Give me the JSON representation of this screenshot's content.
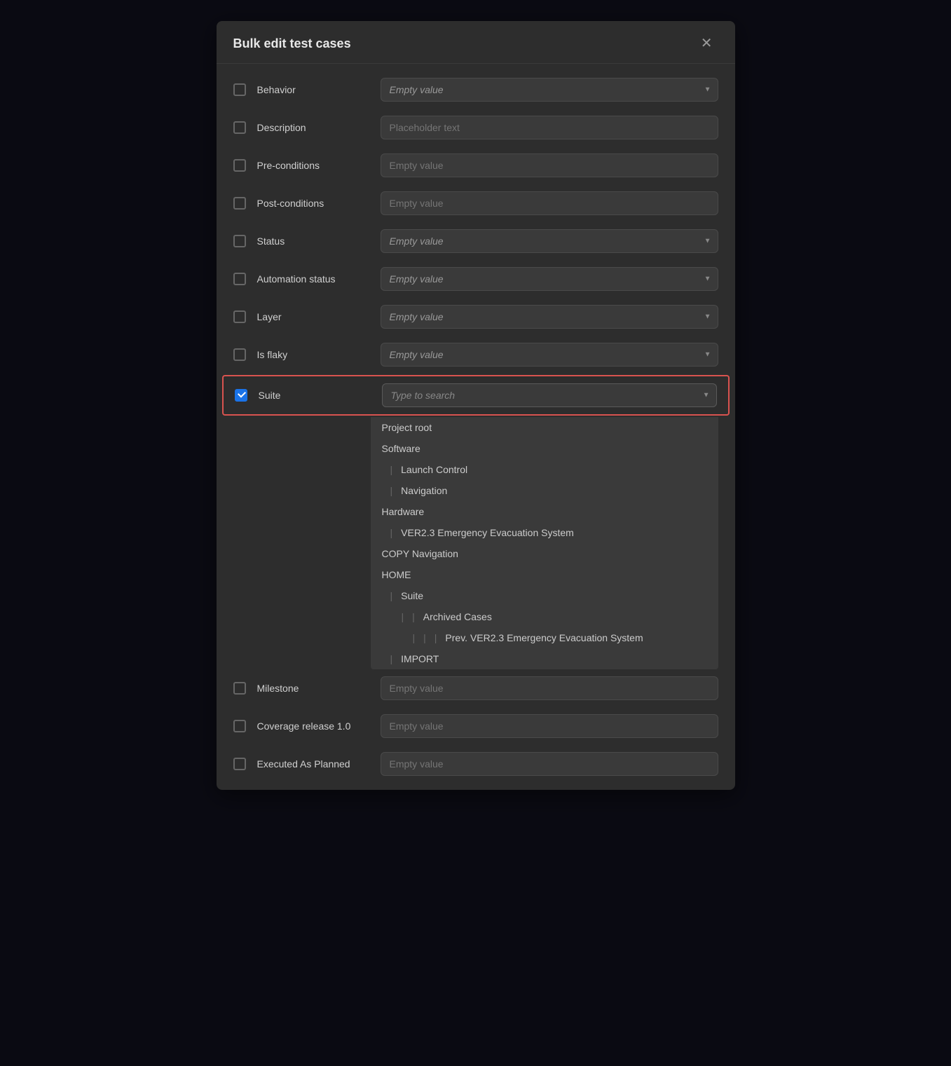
{
  "modal": {
    "title": "Bulk edit test cases",
    "close_label": "✕"
  },
  "fields": [
    {
      "id": "behavior",
      "label": "Behavior",
      "type": "select",
      "value": "Empty value",
      "checked": false
    },
    {
      "id": "description",
      "label": "Description",
      "type": "text",
      "value": "",
      "placeholder": "Placeholder text",
      "checked": false
    },
    {
      "id": "pre-conditions",
      "label": "Pre-conditions",
      "type": "text-plain",
      "value": "",
      "placeholder": "Empty value",
      "checked": false
    },
    {
      "id": "post-conditions",
      "label": "Post-conditions",
      "type": "text-plain",
      "value": "",
      "placeholder": "Empty value",
      "checked": false
    },
    {
      "id": "status",
      "label": "Status",
      "type": "select",
      "value": "Empty value",
      "checked": false
    },
    {
      "id": "automation-status",
      "label": "Automation status",
      "type": "select",
      "value": "Empty value",
      "checked": false
    },
    {
      "id": "layer",
      "label": "Layer",
      "type": "select",
      "value": "Empty value",
      "checked": false
    },
    {
      "id": "is-flaky",
      "label": "Is flaky",
      "type": "select",
      "value": "Empty value",
      "checked": false
    },
    {
      "id": "suite",
      "label": "Suite",
      "type": "search",
      "value": "",
      "placeholder": "Type to search",
      "checked": true,
      "highlighted": true
    },
    {
      "id": "milestone",
      "label": "Milestone",
      "type": "text-plain",
      "value": "",
      "placeholder": "Empty value",
      "checked": false
    },
    {
      "id": "coverage-release",
      "label": "Coverage release 1.0",
      "type": "text-plain",
      "value": "",
      "placeholder": "Empty value",
      "checked": false
    },
    {
      "id": "executed-as-planned",
      "label": "Executed As Planned",
      "type": "text-plain",
      "value": "",
      "placeholder": "Empty value",
      "checked": false
    }
  ],
  "dropdown_items": [
    {
      "label": "Project root",
      "indent": 0
    },
    {
      "label": "Software",
      "indent": 0
    },
    {
      "label": "Launch Control",
      "indent": 1
    },
    {
      "label": "Navigation",
      "indent": 1
    },
    {
      "label": "Hardware",
      "indent": 0
    },
    {
      "label": "VER2.3 Emergency Evacuation System",
      "indent": 1
    },
    {
      "label": "COPY Navigation",
      "indent": 0
    },
    {
      "label": "HOME",
      "indent": 0
    },
    {
      "label": "Suite",
      "indent": 1
    },
    {
      "label": "Archived Cases",
      "indent": 2
    },
    {
      "label": "Prev. VER2.3 Emergency Evacuation System",
      "indent": 3
    },
    {
      "label": "IMPORT",
      "indent": 1
    }
  ]
}
